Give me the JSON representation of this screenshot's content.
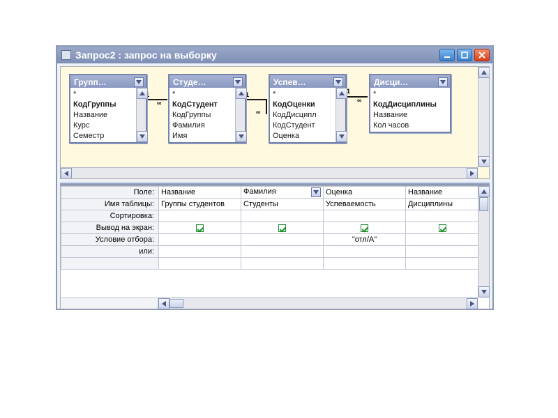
{
  "window": {
    "title": "Запрос2 : запрос на выборку"
  },
  "tables": [
    {
      "name": "Групп…",
      "fields": [
        "*",
        "КодГруппы",
        "Название",
        "Курс",
        "Семестр"
      ],
      "bold_index": 1
    },
    {
      "name": "Студе…",
      "fields": [
        "*",
        "КодСтудент",
        "КодГруппы",
        "Фамилия",
        "Имя"
      ],
      "bold_index": 1
    },
    {
      "name": "Успев…",
      "fields": [
        "*",
        "КодОценки",
        "КодДисципл",
        "КодСтудент",
        "Оценка"
      ],
      "bold_index": 1
    },
    {
      "name": "Дисци…",
      "fields": [
        "*",
        "КодДисциплины",
        "Название",
        "Кол часов"
      ],
      "bold_index": 1
    }
  ],
  "relations": {
    "one_label": "1",
    "many_label": "∞"
  },
  "grid": {
    "row_labels": {
      "field": "Поле:",
      "table": "Имя таблицы:",
      "sort": "Сортировка:",
      "show": "Вывод на экран:",
      "criteria": "Условие отбора:",
      "or": "или:"
    },
    "columns": [
      {
        "field": "Название",
        "table": "Группы студентов",
        "sort": "",
        "show": true,
        "criteria": "",
        "or": "",
        "dropdown": false
      },
      {
        "field": "Фамилия",
        "table": "Студенты",
        "sort": "",
        "show": true,
        "criteria": "",
        "or": "",
        "dropdown": true
      },
      {
        "field": "Оценка",
        "table": "Успеваемость",
        "sort": "",
        "show": true,
        "criteria": "\"отл/А\"",
        "or": "",
        "dropdown": false
      },
      {
        "field": "Название",
        "table": "Дисциплины",
        "sort": "",
        "show": true,
        "criteria": "",
        "or": "",
        "dropdown": false
      }
    ]
  }
}
